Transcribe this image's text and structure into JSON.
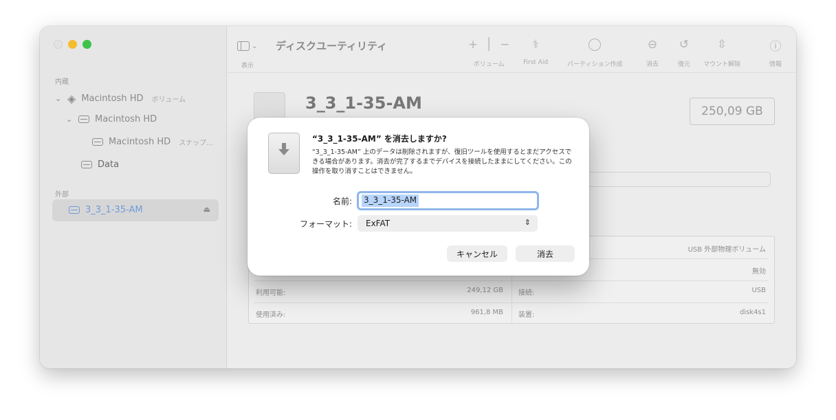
{
  "sidebar": {
    "internal_label": "内蔵",
    "external_label": "外部",
    "items": [
      {
        "label": "Macintosh HD",
        "sub": "ボリューム"
      },
      {
        "label": "Macintosh HD"
      },
      {
        "label": "Macintosh HD",
        "sub": "スナップ..."
      },
      {
        "label": "Data"
      },
      {
        "label": "3_3_1-35-AM"
      }
    ]
  },
  "toolbar": {
    "view_label": "表示",
    "app_title": "ディスクユーティリティ",
    "buttons": [
      {
        "label": "ボリューム"
      },
      {
        "label": "First Aid"
      },
      {
        "label": "パーティション作成"
      },
      {
        "label": "消去"
      },
      {
        "label": "復元"
      },
      {
        "label": "マウント解除"
      },
      {
        "label": "情報"
      }
    ]
  },
  "device": {
    "name": "3_3_1-35-AM",
    "capacity": "250,09 GB"
  },
  "info_table": {
    "rows": [
      {
        "left_label": "",
        "left_value": "",
        "right_label": "",
        "right_value": "USB 外部物理ボリューム"
      },
      {
        "left_label": "",
        "left_value": "",
        "right_label": "",
        "right_value": "無効"
      },
      {
        "left_label": "利用可能:",
        "left_value": "249,12 GB",
        "right_label": "接続:",
        "right_value": "USB"
      },
      {
        "left_label": "使用済み:",
        "left_value": "961,8 MB",
        "right_label": "装置:",
        "right_value": "disk4s1"
      }
    ]
  },
  "dialog": {
    "title": "“3_3_1-35-AM” を消去しますか?",
    "message": "“3_3_1-35-AM” 上のデータは削除されますが、復旧ツールを使用するとまだアクセスできる場合があります。消去が完了するまでデバイスを接続したままにしてください。この操作を取り消すことはできません。",
    "name_label": "名前:",
    "name_value": "3_3_1-35-AM",
    "format_label": "フォーマット:",
    "format_value": "ExFAT",
    "cancel_label": "キャンセル",
    "erase_label": "消去"
  },
  "colors": {
    "accent": "#8fb6ea",
    "traffic_yellow": "#f3bd2d",
    "traffic_green": "#3fc24a"
  }
}
